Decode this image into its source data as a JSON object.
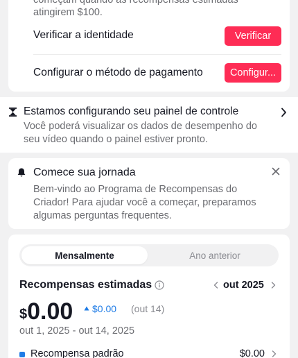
{
  "verify_card": {
    "intro_line1": "começam quando as recompensas estimadas",
    "intro_line2": "atingirem $100.",
    "identity_label": "Verificar a identidade",
    "identity_button": "Verificar",
    "payment_label": "Configurar o método de pagamento",
    "payment_button": "Configur..."
  },
  "dashboard_banner": {
    "title": "Estamos configurando seu painel de controle",
    "line1": "Você poderá visualizar os dados de desempenho do",
    "line2": "seu vídeo quando o painel estiver pronto."
  },
  "journey_card": {
    "title": "Comece sua jornada",
    "line1": "Bem-vindo ao Programa de Recompensas do",
    "line2": "Criador! Para ajudar você a começar, preparamos",
    "line3": "algumas perguntas frequentes."
  },
  "rewards": {
    "tabs": [
      "Mensalmente",
      "Ano anterior"
    ],
    "title": "Recompensas estimadas",
    "month": "out 2025",
    "currency": "$",
    "amount": "0.00",
    "change": "$0.00",
    "change_note": "(out 14)",
    "date_range": "out 1, 2025 - out 14, 2025",
    "breakdown": [
      {
        "label": "Recompensa padrão",
        "value": "$0.00"
      }
    ]
  },
  "colors": {
    "accent_red": "#fe2c55",
    "accent_blue": "#1f7ce6",
    "background": "#f1f1f2"
  }
}
